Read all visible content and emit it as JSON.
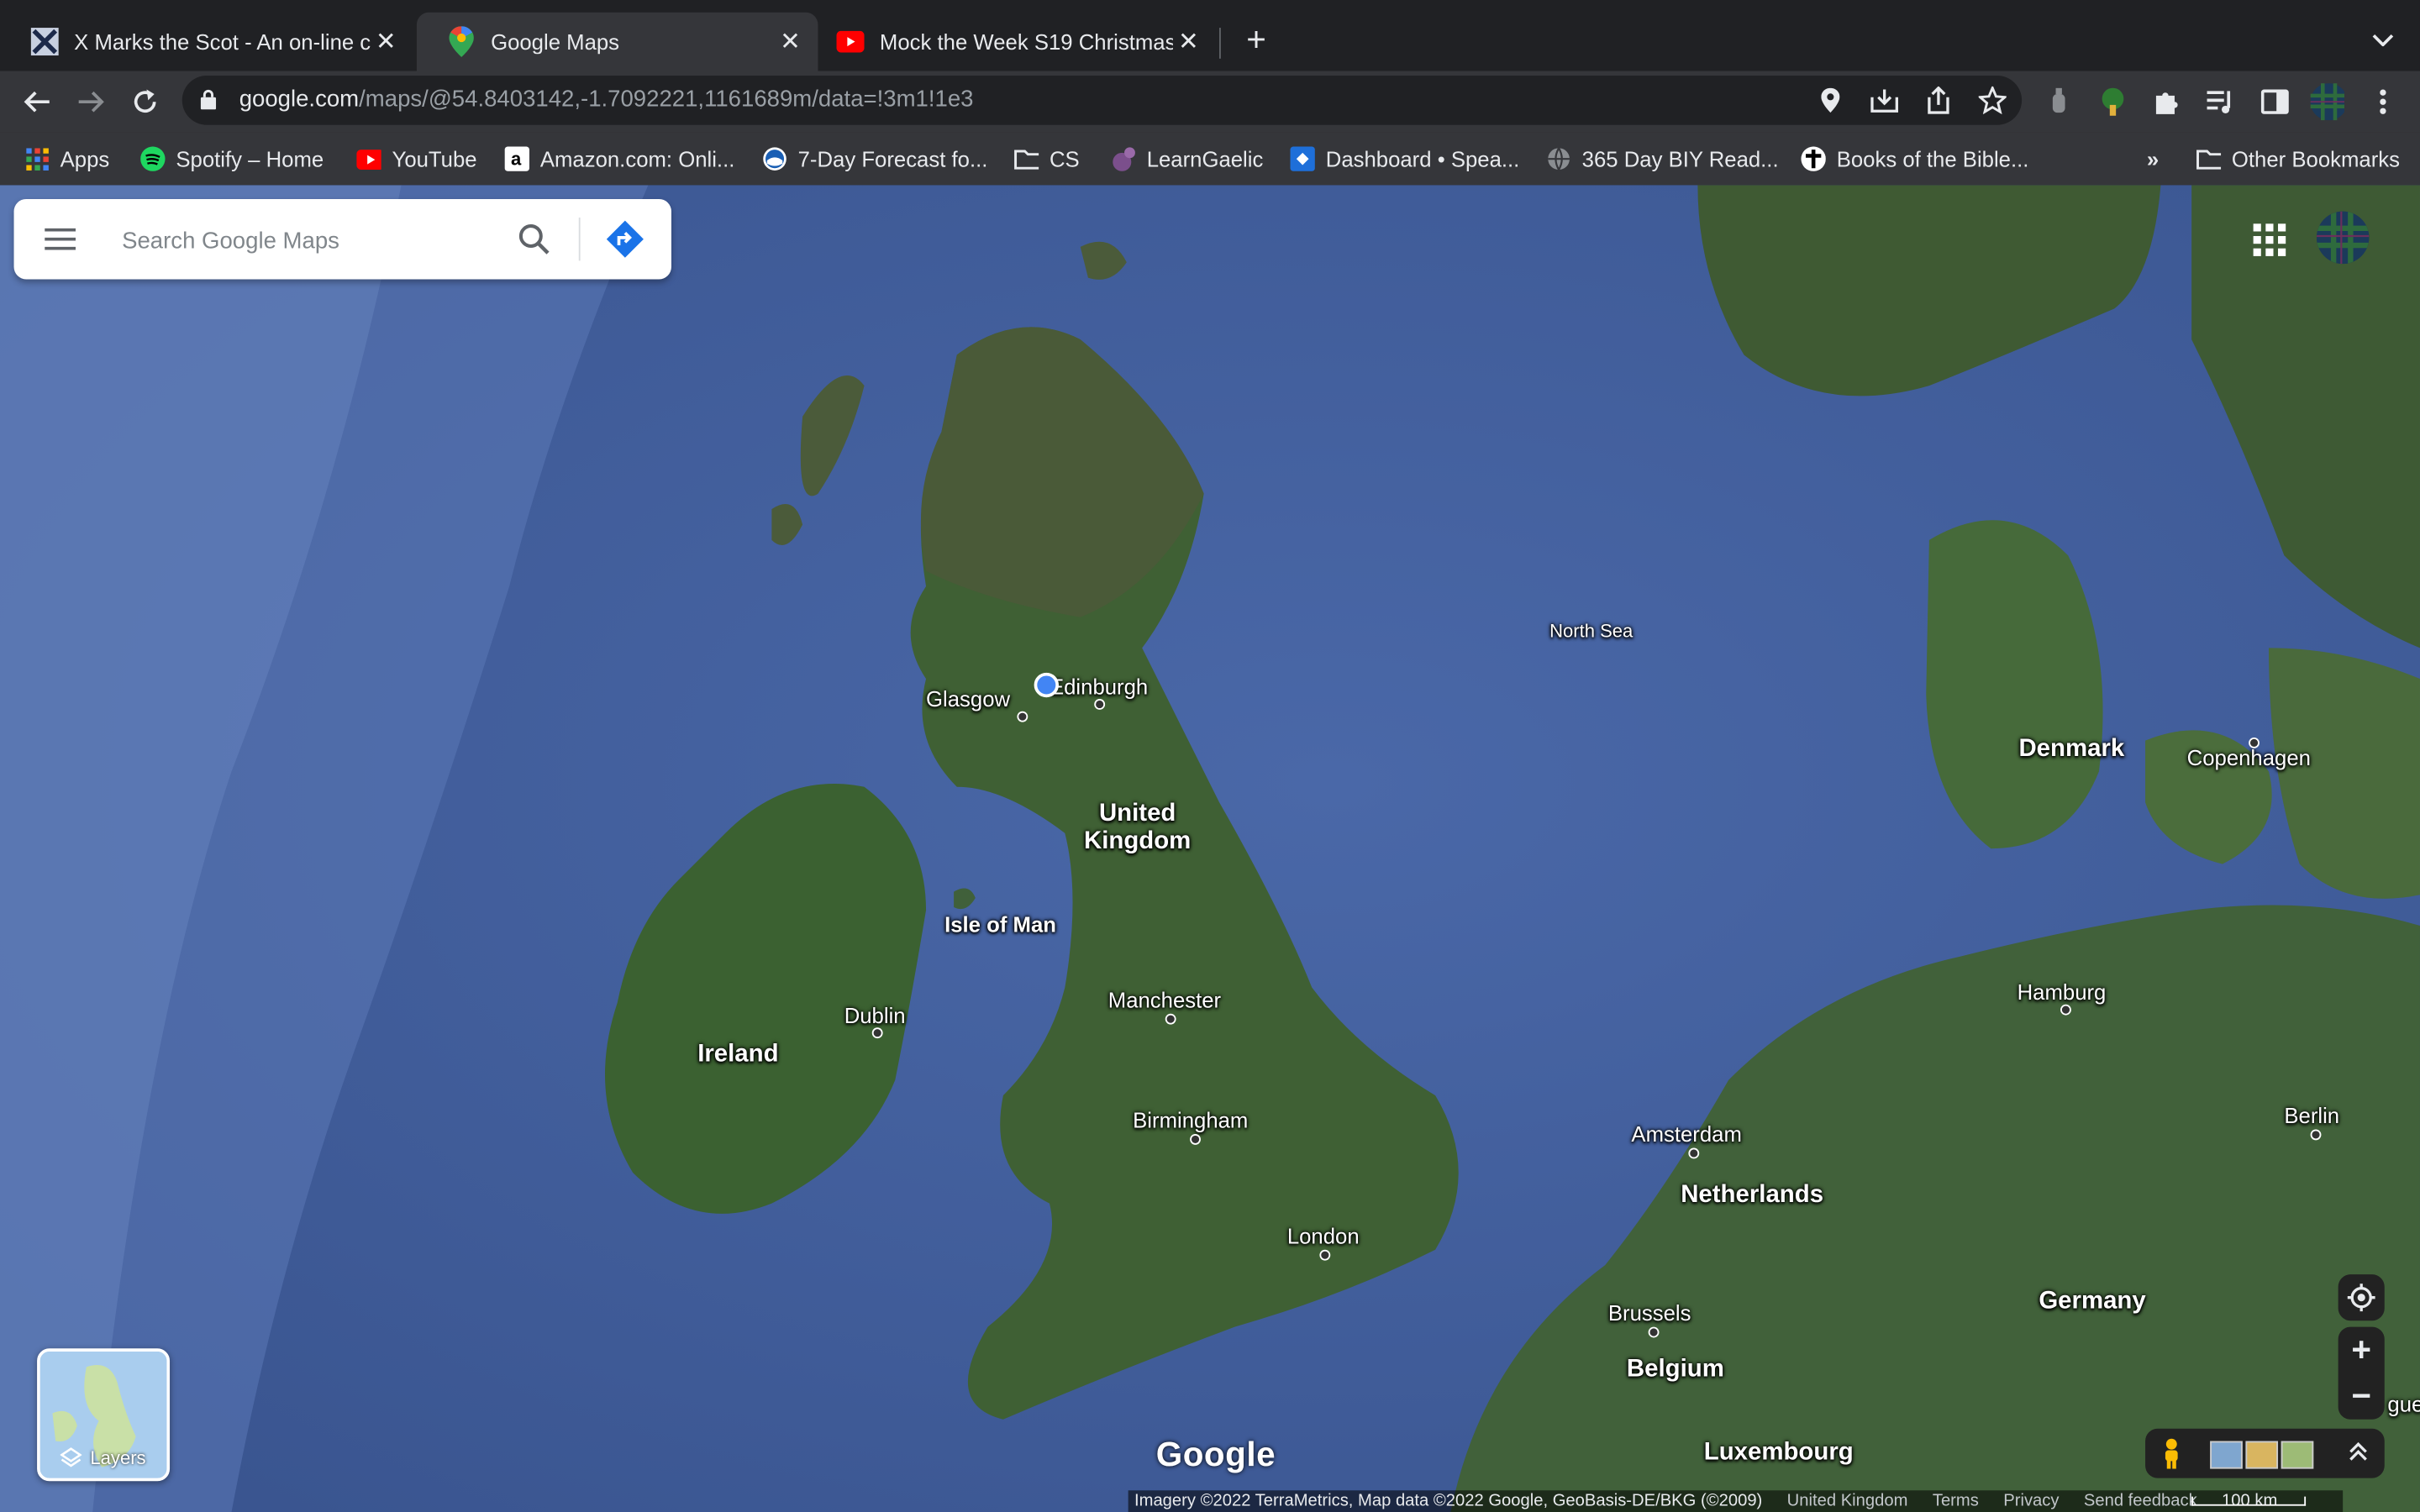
{
  "browser": {
    "tabs": [
      {
        "title": "X Marks the Scot - An on-line c",
        "favicon": "x-marks-the-scot-icon",
        "active": false
      },
      {
        "title": "Google Maps",
        "favicon": "google-maps-pin-icon",
        "active": true
      },
      {
        "title": "Mock the Week S19 Christmas",
        "favicon": "youtube-icon",
        "active": false
      }
    ],
    "address": {
      "host": "google.com",
      "path": "/maps/@54.8403142,-1.7092221,1161689m/data=!3m1!1e3"
    },
    "bookmarks": [
      {
        "label": "Apps",
        "icon": "apps-grid-icon"
      },
      {
        "label": "Spotify – Home",
        "icon": "spotify-icon"
      },
      {
        "label": "YouTube",
        "icon": "youtube-icon"
      },
      {
        "label": "Amazon.com: Onli...",
        "icon": "amazon-icon"
      },
      {
        "label": "7-Day Forecast fo...",
        "icon": "noaa-icon"
      },
      {
        "label": "CS",
        "icon": "folder-icon"
      },
      {
        "label": "LearnGaelic",
        "icon": "learngaelic-icon"
      },
      {
        "label": "Dashboard • Spea...",
        "icon": "dashboard-icon"
      },
      {
        "label": "365 Day BIY Read...",
        "icon": "globe-icon"
      },
      {
        "label": "Books of the Bible...",
        "icon": "bible-icon"
      }
    ],
    "bookmarks_overflow": "»",
    "other_bookmarks": "Other Bookmarks"
  },
  "maps": {
    "search_placeholder": "Search Google Maps",
    "labels": {
      "glasgow": "Glasgow",
      "edinburgh": "Edinburgh",
      "united_kingdom": "United Kingdom",
      "isle_of_man": "Isle of Man",
      "dublin": "Dublin",
      "ireland": "Ireland",
      "manchester": "Manchester",
      "birmingham": "Birmingham",
      "london": "London",
      "north_sea": "North Sea",
      "denmark": "Denmark",
      "copenhagen": "Copenhagen",
      "hamburg": "Hamburg",
      "amsterdam": "Amsterdam",
      "netherlands": "Netherlands",
      "berlin": "Berlin",
      "brussels": "Brussels",
      "belgium": "Belgium",
      "germany": "Germany",
      "luxembourg": "Luxembourg",
      "edge_label": "gue"
    },
    "layers_label": "Layers",
    "logo": "Google",
    "attribution": {
      "imagery": "Imagery ©2022 TerraMetrics, Map data ©2022 Google, GeoBasis-DE/BKG (©2009)",
      "region": "United Kingdom",
      "terms": "Terms",
      "privacy": "Privacy",
      "feedback": "Send feedback",
      "scale": "100 km"
    }
  },
  "colors": {
    "sea": "#3c5894",
    "land": "#3d5a35",
    "chrome_dark": "#202124",
    "chrome_toolbar": "#35363a",
    "google_blue": "#4285f4"
  }
}
